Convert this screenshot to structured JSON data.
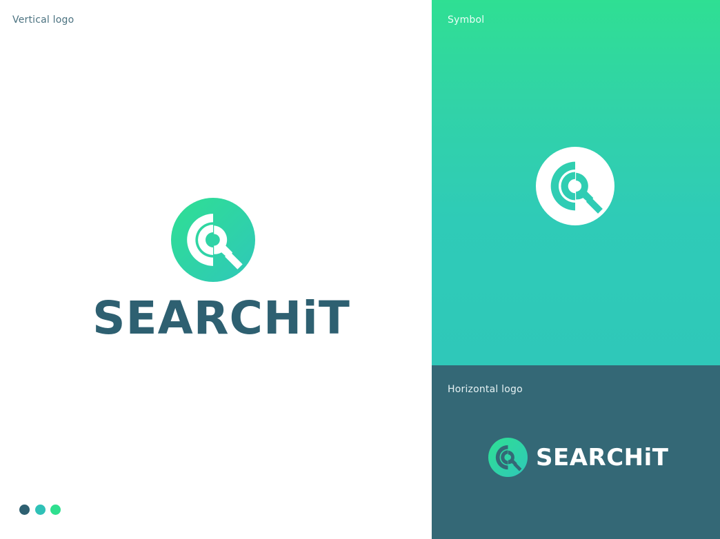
{
  "panels": {
    "vertical": {
      "label": "Vertical logo"
    },
    "symbol": {
      "label": "Symbol"
    },
    "horizontal": {
      "label": "Horizontal logo"
    }
  },
  "brand": {
    "name": "SEARCHiT"
  },
  "colors": {
    "dark_teal": "#346876",
    "wordmark_teal": "#2e6071",
    "teal": "#2fc8b9",
    "green": "#2fdf93"
  },
  "swatches": [
    "#2e6071",
    "#2fc1b7",
    "#2fdf8f"
  ],
  "icons": {
    "logo_symbol": "magnifier-circle-logo"
  }
}
